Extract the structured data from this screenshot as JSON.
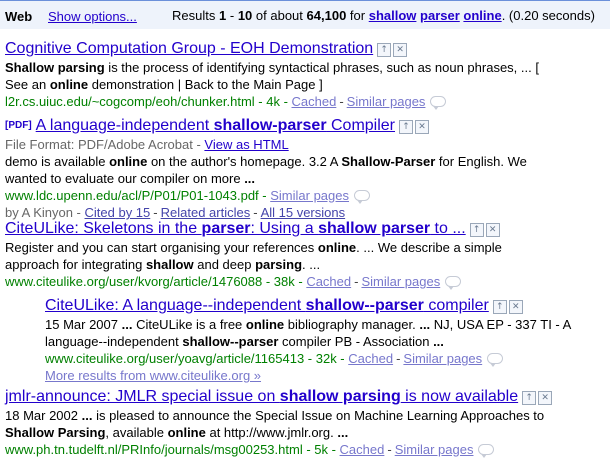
{
  "topbar": {
    "web_label": "Web",
    "show_options": "Show options...",
    "results_prefix": "Results",
    "range_start": "1",
    "range_sep": "-",
    "range_end": "10",
    "of_about": "of about",
    "total": "64,100",
    "for": "for",
    "q1": "shallow",
    "q2": "parser",
    "q3": "online",
    "time": "(0.20 seconds)"
  },
  "results": [
    {
      "title": "Cognitive Computation Group - EOH Demonstration",
      "snippet1_b1": "Shallow parsing",
      "snippet1_rest": " is the process of identifying syntactical phrases, such as noun phrases, ... [",
      "snippet2_a": "See an ",
      "snippet2_b": "online",
      "snippet2_c": " demonstration | Back to the Main Page ]",
      "url": "l2r.cs.uiuc.edu/~cogcomp/eoh/chunker.html - 4k - ",
      "cached": "Cached",
      "similar": "Similar pages"
    },
    {
      "pdf": "[PDF]",
      "title_a": "A language-independent ",
      "title_b": "shallow-parser",
      "title_c": " Compiler",
      "format_label": "File Format: PDF/Adobe Acrobat - ",
      "view_html": "View as HTML",
      "snippet1_a": "demo is available ",
      "snippet1_b": "online",
      "snippet1_c": " on the author's homepage. 3.2 A ",
      "snippet1_d": "Shallow-Parser",
      "snippet1_e": " for English. We",
      "snippet2": "wanted to evaluate our compiler on more ",
      "snippet2_b": "...",
      "url": "www.ldc.upenn.edu/acl/P/P01/P01-1043.pdf - ",
      "similar": "Similar pages",
      "author": "by A Kinyon - ",
      "cited": "Cited by 15",
      "related": "Related articles",
      "versions": "All 15 versions"
    },
    {
      "title_a": "CiteULike: Skeletons in the ",
      "title_b": "parser",
      "title_c": ": Using a ",
      "title_d": "shallow parser",
      "title_e": " to ...",
      "snippet1_a": "Register and you can start organising your references ",
      "snippet1_b": "online",
      "snippet1_c": ". ... We describe a simple",
      "snippet2_a": "approach for integrating ",
      "snippet2_b": "shallow",
      "snippet2_c": " and deep ",
      "snippet2_d": "parsing",
      "snippet2_e": ". ...",
      "url": "www.citeulike.org/user/kvorg/article/1476088 - 38k - ",
      "cached": "Cached",
      "similar": "Similar pages"
    },
    {
      "title_a": "CiteULike: A language--independent ",
      "title_b": "shallow--parser",
      "title_c": " compiler",
      "snippet1_a": "15 Mar 2007 ",
      "snippet1_b": "...",
      "snippet1_c": " CiteULike is a free ",
      "snippet1_d": "online",
      "snippet1_e": " bibliography manager. ",
      "snippet1_f": "...",
      "snippet1_g": " NJ, USA EP - 337 TI - A",
      "snippet2_a": "language--independent ",
      "snippet2_b": "shallow--parser",
      "snippet2_c": " compiler PB - Association ",
      "snippet2_d": "...",
      "url": "www.citeulike.org/user/yoavg/article/1165413 - 32k - ",
      "cached": "Cached",
      "similar": "Similar pages",
      "more": "More results from www.citeulike.org »"
    },
    {
      "title_a": "jmlr-announce: JMLR special issue on ",
      "title_b": "shallow parsing",
      "title_c": " is now available",
      "snippet1_a": "18 Mar 2002 ",
      "snippet1_b": "...",
      "snippet1_c": " is pleased to announce the Special Issue on Machine Learning Approaches to",
      "snippet2_a": "Shallow Parsing",
      "snippet2_b": ", available ",
      "snippet2_c": "online",
      "snippet2_d": " at http://www.jmlr.org. ",
      "snippet2_e": "...",
      "url": "www.ph.tn.tudelft.nl/PRInfo/journals/msg00253.html - 5k - ",
      "cached": "Cached",
      "similar": "Similar pages"
    }
  ],
  "icons": {
    "promote": "↑",
    "remove": "✕",
    "comment": "comment-bubble"
  },
  "colors": {
    "title_link": "#2200cc",
    "url_green": "#008000",
    "topbar_bg": "#eef3fb"
  }
}
